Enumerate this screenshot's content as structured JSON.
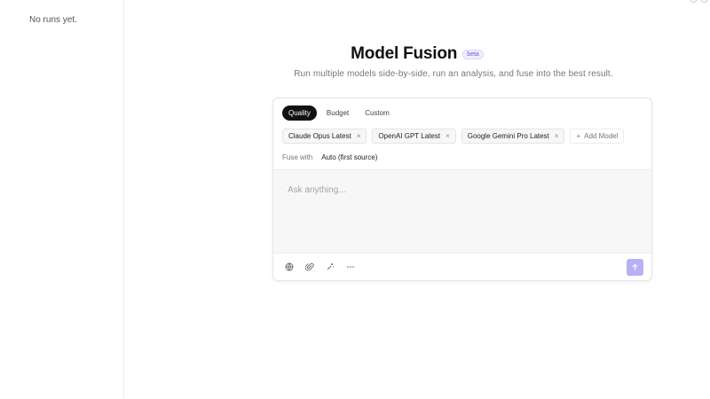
{
  "sidebar": {
    "empty_text": "No runs yet."
  },
  "header": {
    "title": "Model Fusion",
    "badge": "beta",
    "subtitle": "Run multiple models side-by-side, run an analysis, and fuse into the best result."
  },
  "composer": {
    "tabs": [
      {
        "label": "Quality",
        "active": true
      },
      {
        "label": "Budget",
        "active": false
      },
      {
        "label": "Custom",
        "active": false
      }
    ],
    "models": [
      {
        "label": "Claude Opus Latest",
        "remove": "×"
      },
      {
        "label": "OpenAI GPT Latest",
        "remove": "×"
      },
      {
        "label": "Google Gemini Pro Latest",
        "remove": "×"
      }
    ],
    "add_model": {
      "plus": "+",
      "label": "Add Model"
    },
    "fuse": {
      "label": "Fuse with",
      "value": "Auto (first source)"
    },
    "input": {
      "placeholder": "Ask anything..."
    },
    "tools": [
      "globe-icon",
      "paperclip-icon",
      "sparkle-icon",
      "more-icon"
    ],
    "send_icon": "arrow-up-icon"
  },
  "colors": {
    "accent": "#b8b0f5",
    "badge_text": "#6b5bd6",
    "active_tab": "#111111"
  }
}
